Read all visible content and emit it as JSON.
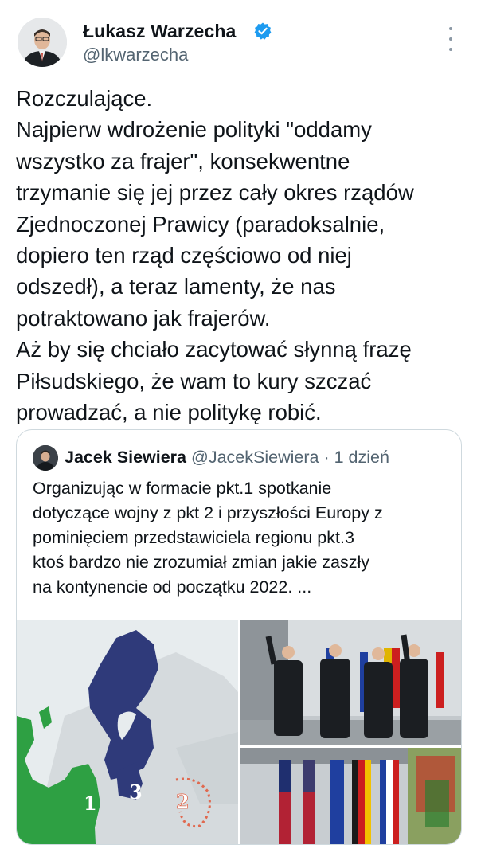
{
  "author": {
    "name": "Łukasz Warzecha",
    "handle": "@lkwarzecha",
    "verified_color": "#1d9bf0"
  },
  "tweet": {
    "lines": [
      "Rozczulające.",
      "Najpierw wdrożenie polityki \"oddamy",
      "wszystko za frajer\", konsekwentne",
      "trzymanie się jej przez cały okres rządów",
      "Zjednoczonej Prawicy (paradoksalnie,",
      "dopiero ten rząd częściowo od niej",
      "odszedł), a teraz lamenty, że nas",
      "potraktowano jak frajerów.",
      "Aż by się chciało zacytować słynną frazę",
      "Piłsudskiego, że wam to kury szczać",
      "prowadzać, a nie politykę robić."
    ]
  },
  "quote": {
    "name": "Jacek Siewiera",
    "handle": "@JacekSiewiera",
    "separator": "·",
    "time": "1 dzień",
    "lines": [
      "Organizując w formacie pkt.1 spotkanie",
      "dotyczące wojny z pkt 2 i przyszłości Europy z",
      "pominięciem przedstawiciela regionu pkt.3",
      "ktoś bardzo nie zrozumiał zmian jakie zaszły",
      "na kontynencie od początku 2022. ..."
    ],
    "map_labels": [
      "1",
      "2",
      "3"
    ]
  },
  "colors": {
    "text": "#0f1419",
    "muted": "#536471",
    "border": "#cfd9de",
    "map_green": "#2ea043",
    "map_navy": "#2f3a7a",
    "map_dotted": "#e0694f"
  }
}
